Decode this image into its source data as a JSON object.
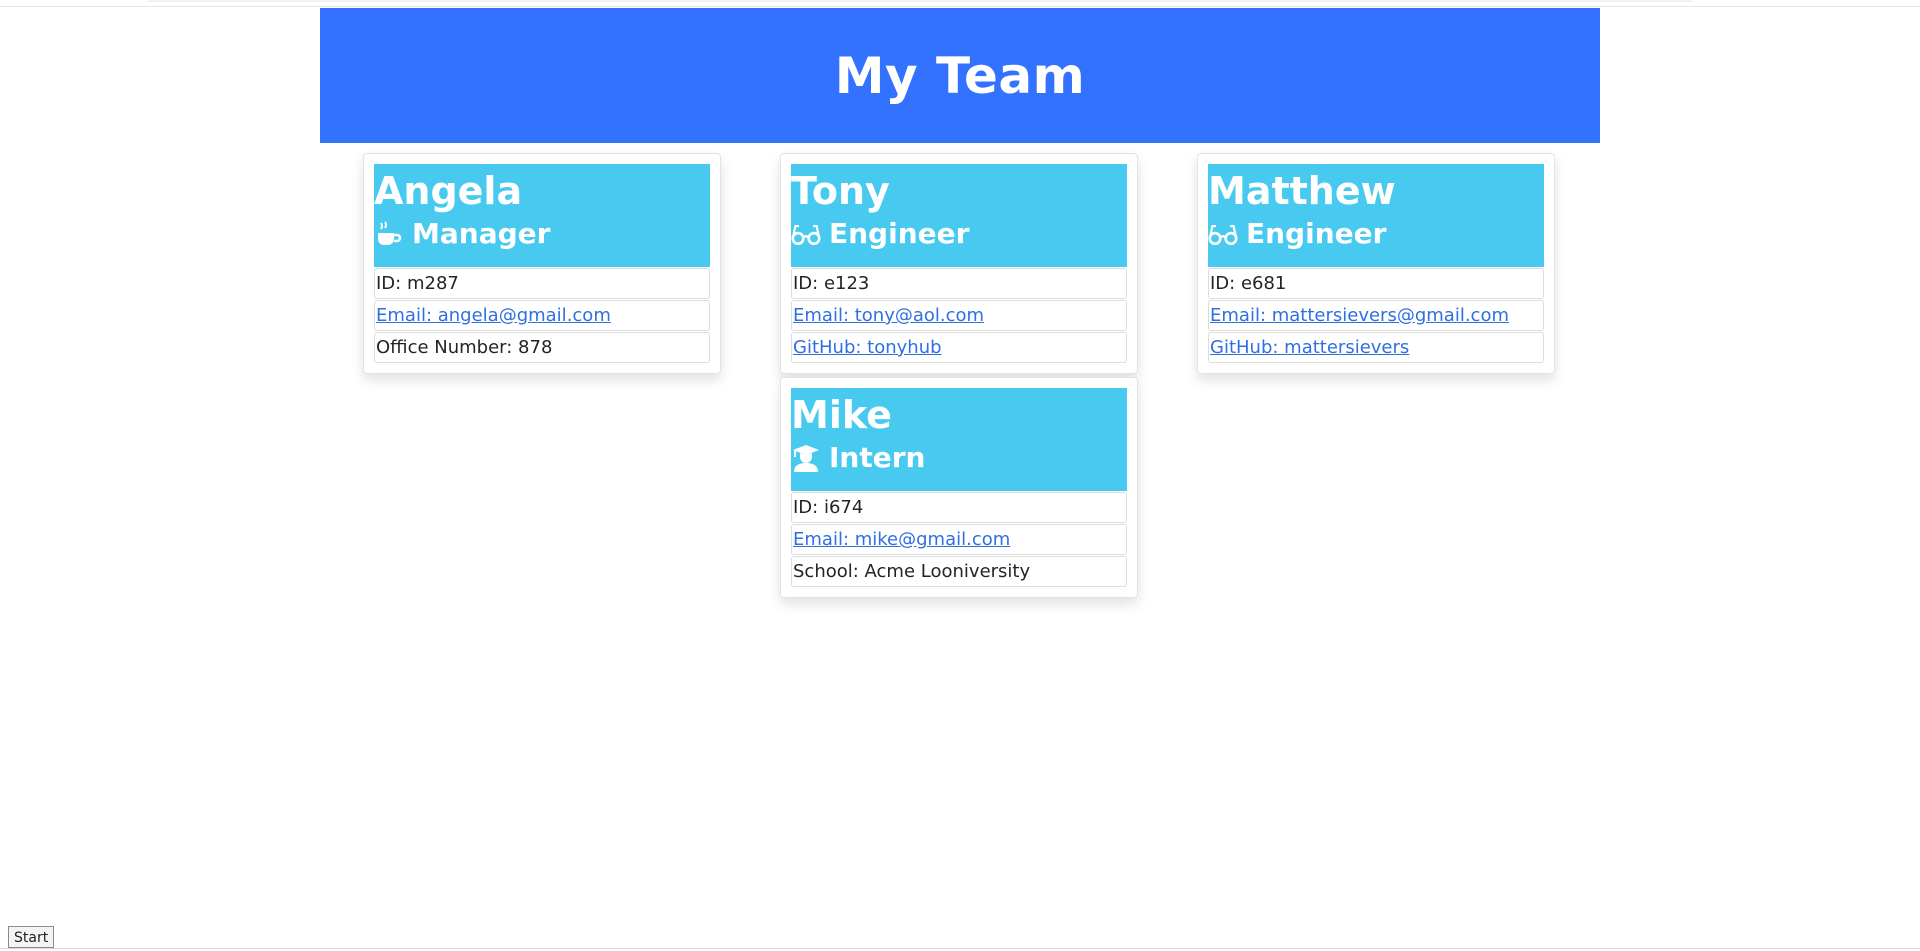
{
  "header": {
    "title": "My Team"
  },
  "colors": {
    "banner": "#3371ff",
    "card_header": "#48caf0",
    "link": "#2f6fe0"
  },
  "employees": [
    {
      "name": "Angela",
      "role": "Manager",
      "icon": "coffee-icon",
      "id_text": "ID: m287",
      "email_text": "Email: angela@gmail.com",
      "extra_text": "Office Number: 878"
    },
    {
      "name": "Tony",
      "role": "Engineer",
      "icon": "glasses-icon",
      "id_text": "ID: e123",
      "email_text": "Email: tony@aol.com",
      "extra_text": "GitHub: tonyhub"
    },
    {
      "name": "Matthew",
      "role": "Engineer",
      "icon": "glasses-icon",
      "id_text": "ID: e681",
      "email_text": "Email: mattersievers@gmail.com",
      "extra_text": "GitHub: mattersievers"
    },
    {
      "name": "Mike",
      "role": "Intern",
      "icon": "graduate-icon",
      "id_text": "ID: i674",
      "email_text": "Email: mike@gmail.com",
      "extra_text": "School: Acme Looniversity"
    }
  ],
  "taskbar": {
    "start_label": "Start"
  }
}
